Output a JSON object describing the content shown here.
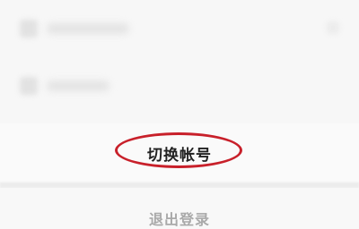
{
  "menu": {
    "switch_account_label": "切换帐号",
    "logout_label": "退出登录"
  },
  "colors": {
    "highlight_oval": "#c8202a",
    "switch_text": "#222222",
    "logout_text": "#a9a9a9"
  }
}
